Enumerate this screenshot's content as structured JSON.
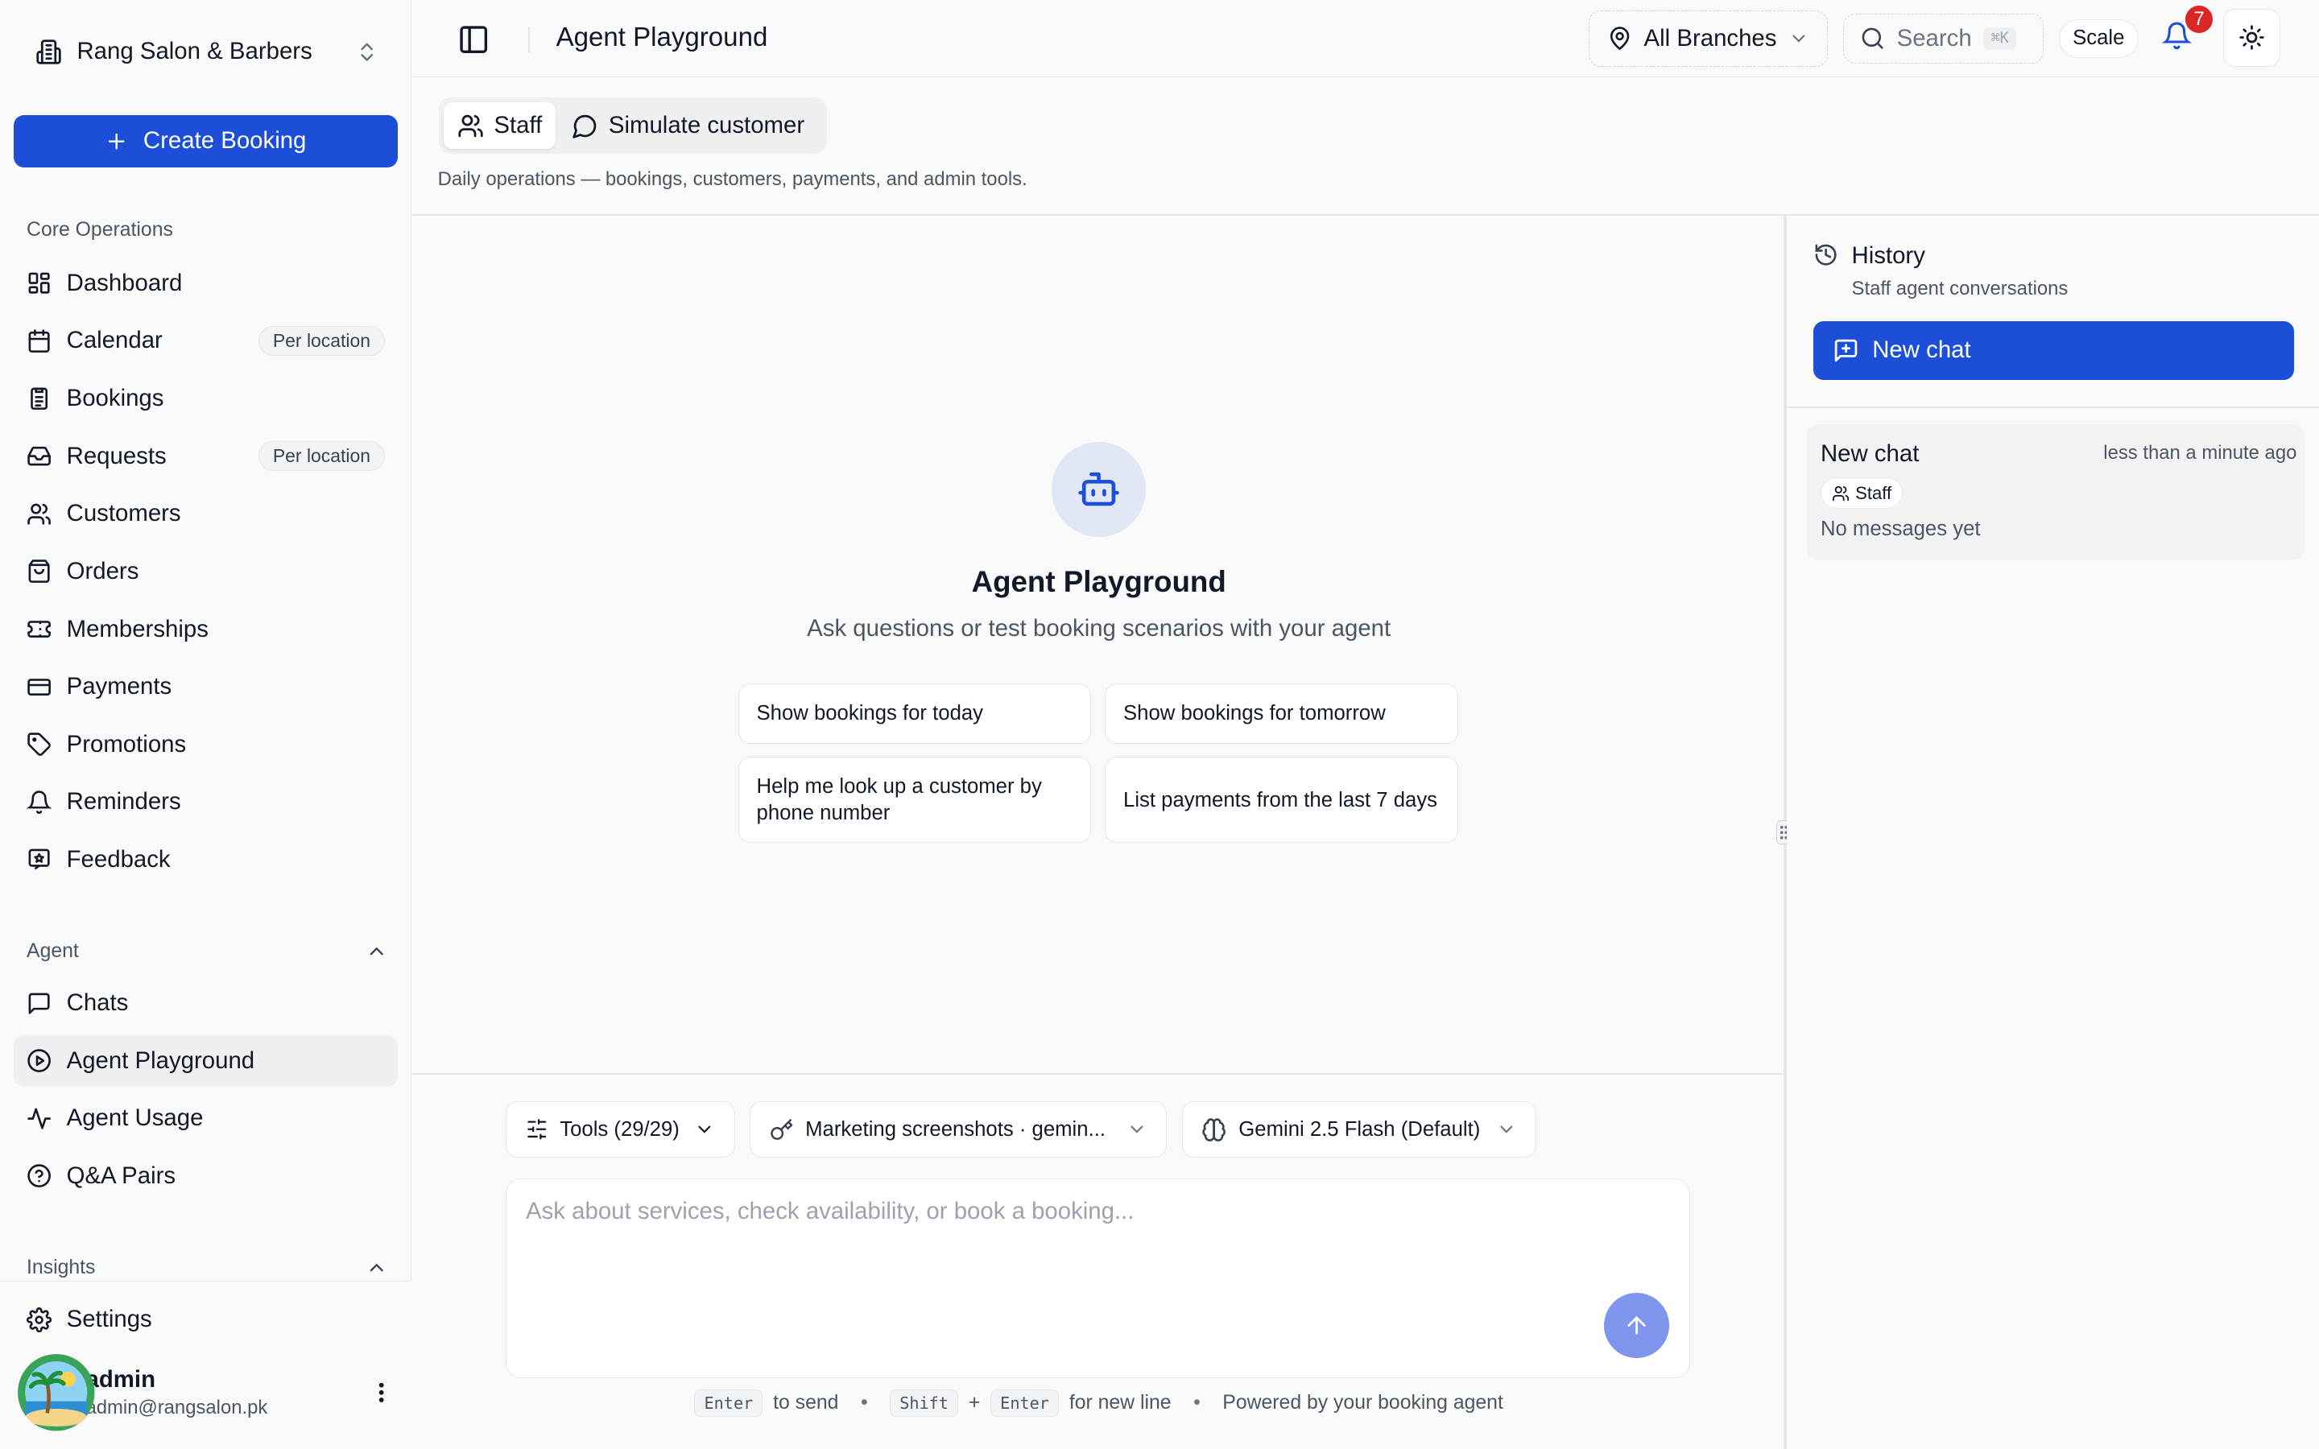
{
  "org": {
    "name": "Rang Salon & Barbers"
  },
  "sidebar": {
    "create_label": "Create Booking",
    "core_label": "Core Operations",
    "core_items": [
      {
        "label": "Dashboard"
      },
      {
        "label": "Calendar",
        "badge": "Per location"
      },
      {
        "label": "Bookings"
      },
      {
        "label": "Requests",
        "badge": "Per location"
      },
      {
        "label": "Customers"
      },
      {
        "label": "Orders"
      },
      {
        "label": "Memberships"
      },
      {
        "label": "Payments"
      },
      {
        "label": "Promotions"
      },
      {
        "label": "Reminders"
      },
      {
        "label": "Feedback"
      }
    ],
    "agent_label": "Agent",
    "agent_items": [
      {
        "label": "Chats"
      },
      {
        "label": "Agent Playground",
        "active": true
      },
      {
        "label": "Agent Usage"
      },
      {
        "label": "Q&A Pairs"
      }
    ],
    "insights_label": "Insights",
    "settings_label": "Settings",
    "user": {
      "name": "admin",
      "email": "admin@rangsalon.pk"
    }
  },
  "topbar": {
    "title": "Agent Playground",
    "branch": "All Branches",
    "search": "Search",
    "shortcut": "⌘K",
    "scale": "Scale",
    "notifications": "7"
  },
  "modes": {
    "staff": "Staff",
    "simulate": "Simulate customer",
    "description": "Daily operations — bookings, customers, payments, and admin tools."
  },
  "empty_state": {
    "title": "Agent Playground",
    "subtitle": "Ask questions or test booking scenarios with your agent",
    "suggestions": [
      "Show bookings for today",
      "Show bookings for tomorrow",
      "Help me look up a customer by phone number",
      "List payments from the last 7 days"
    ]
  },
  "composer": {
    "tools": "Tools (29/29)",
    "key": "Marketing screenshots · gemin...",
    "model": "Gemini 2.5 Flash (Default)",
    "placeholder": "Ask about services, check availability, or book a booking...",
    "hint": {
      "enter_key": "Enter",
      "to_send": "to send",
      "shift_key": "Shift",
      "plus": "+",
      "for_new_line": "for new line",
      "powered": "Powered by your booking agent"
    }
  },
  "history": {
    "title": "History",
    "subtitle": "Staff agent conversations",
    "new_chat": "New chat",
    "conversations": [
      {
        "title": "New chat",
        "time": "less than a minute ago",
        "tag": "Staff",
        "preview": "No messages yet"
      }
    ]
  },
  "colors": {
    "primary": "#1d4ed8",
    "send_button": "#8095ee",
    "badge": "#dc2626"
  }
}
